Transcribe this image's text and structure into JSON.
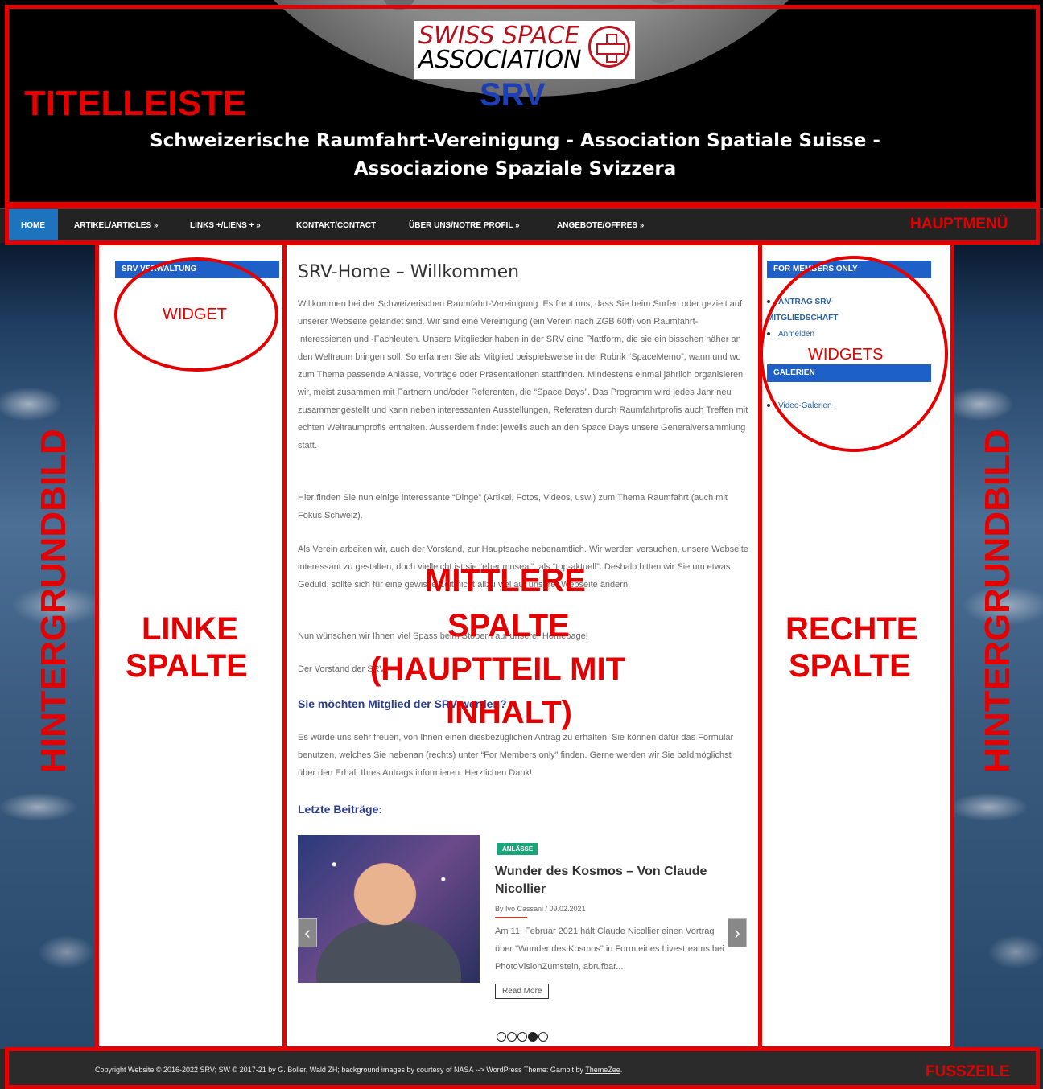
{
  "header": {
    "logo_line1_a": "SWISS SPACE",
    "logo_line2": "ASSOCIATION",
    "logo_srv": "SRV",
    "tagline": "Schweizerische Raumfahrt-Vereinigung - Association Spatiale Suisse - Associazione Spaziale Svizzera"
  },
  "nav": {
    "items": [
      {
        "label": "HOME"
      },
      {
        "label": "ARTIKEL/ARTICLES »"
      },
      {
        "label": "LINKS +/LIENS + »"
      },
      {
        "label": "KONTAKT/CONTACT"
      },
      {
        "label": "ÜBER UNS/NOTRE PROFIL »"
      },
      {
        "label": "ANGEBOTE/OFFRES »"
      }
    ]
  },
  "left_sidebar": {
    "widget_title": "SRV VERWALTUNG"
  },
  "main": {
    "title": "SRV-Home – Willkommen",
    "p1": "Willkommen bei der Schweizerischen Raumfahrt-Vereinigung. Es freut uns, dass Sie beim Surfen oder gezielt auf unserer Webseite gelandet sind. Wir sind eine Vereinigung (ein Verein nach ZGB 60ff) von Raumfahrt-Interessierten und -Fachleuten. Unsere Mitglieder haben in der SRV eine Plattform, die sie ein bisschen näher an den Weltraum bringen soll. So erfahren Sie als Mitglied beispielsweise in der Rubrik “SpaceMemo”, wann und wo zum Thema passende Anlässe, Vorträge oder Präsentationen stattfinden. Mindestens einmal jährlich organisieren wir, meist zusammen mit Partnern und/oder Referenten, die “Space Days”. Das Programm wird jedes Jahr neu zusammengestellt und kann neben interessanten Ausstellungen, Referaten durch Raumfahrtprofis auch Treffen mit echten Weltraumprofis enthalten. Ausserdem findet jeweils auch an den Space Days unsere Generalversammlung statt.",
    "p2": "Hier finden Sie nun einige interessante “Dinge” (Artikel, Fotos, Videos, usw.) zum Thema Raumfahrt (auch mit Fokus Schweiz).",
    "p3": "Als Verein arbeiten wir, auch der Vorstand, zur Hauptsache nebenamtlich. Wir werden versuchen, unsere Webseite interessant zu gestalten, doch vielleicht ist sie “eher museal”, als “top-aktuell”. Deshalb bitten wir Sie um etwas Geduld, sollte sich für eine gewisse Zeit nicht allzu viel auf unserer Webseite ändern.",
    "p4": "Nun wünschen wir Ihnen viel Spass beim Stöbern auf unserer Homepage!",
    "p5": "Der Vorstand der SRV",
    "subhead1": "Sie möchten Mitglied der SRV werden?",
    "p6": "Es würde uns sehr freuen, von Ihnen einen diesbezüglichen Antrag zu erhalten! Sie können dafür das Formular benutzen, welches Sie nebenan (rechts) unter “For Members only” finden. Gerne werden wir Sie baldmöglichst über den Erhalt Ihres Antrags informieren. Herzlichen Dank!",
    "subhead2": "Letzte Beiträge:",
    "post": {
      "badge": "ANLÄSSE",
      "title": "Wunder des Kosmos – Von Claude Nicollier",
      "meta": "By Ivo Cassani / 09.02.2021",
      "excerpt": "Am 11. Februar 2021 hält Claude Nicollier einen Vortrag über \"Wunder des Kosmos\" in Form eines Livestreams bei PhotoVisionZumstein, abrufbar...",
      "read_more": "Read More",
      "prev": "‹",
      "next": "›"
    }
  },
  "right_sidebar": {
    "widget1_title": "FOR MEMBERS ONLY",
    "item1": "ANTRAG SRV-MITGLIEDSCHAFT",
    "item2": "Anmelden",
    "widget2_title": "GALERIEN",
    "item3": "Video-Galerien"
  },
  "footer": {
    "text": "Copyright Website © 2016-2022 SRV; SW © 2017-21 by G. Boller, Wald ZH; background images by courtesy of NASA --> WordPress Theme: Gambit by ",
    "link": "ThemeZee",
    "end": "."
  },
  "annotations": {
    "titelleiste": "TITELLEISTE",
    "hauptmenue": "HAUPTMENÜ",
    "widget": "WIDGET",
    "widgets": "WIDGETS",
    "linke1": "LINKE",
    "linke2": "SPALTE",
    "rechte1": "RECHTE",
    "rechte2": "SPALTE",
    "mitte1": "MITTLERE",
    "mitte2": "SPALTE",
    "mitte3": "(HAUPTTEIL MIT",
    "mitte4": "INHALT)",
    "hintergrund": "HINTERGRUNDBILD",
    "fusszeile": "FUSSZEILE"
  }
}
